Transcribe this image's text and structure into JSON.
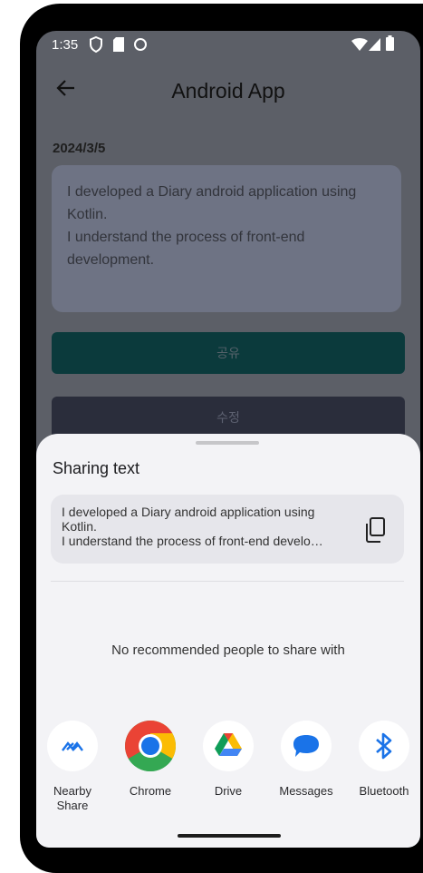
{
  "status_bar": {
    "time": "1:35"
  },
  "app_bar": {
    "title": "Android App"
  },
  "diary": {
    "date": "2024/3/5",
    "content": "I developed a Diary android application using Kotlin.\nI understand the process of front-end development."
  },
  "buttons": {
    "share_label": "공유",
    "edit_label": "수정"
  },
  "share_sheet": {
    "title": "Sharing text",
    "preview_text": "I developed a Diary android application using Kotlin.\nI understand the process of front-end develo…",
    "no_recommendations": "No recommended people to share with",
    "apps": [
      {
        "label": "Nearby Share",
        "icon": "nearby-share-icon"
      },
      {
        "label": "Chrome",
        "icon": "chrome-icon"
      },
      {
        "label": "Drive",
        "icon": "drive-icon"
      },
      {
        "label": "Messages",
        "icon": "messages-icon"
      },
      {
        "label": "Bluetooth",
        "icon": "bluetooth-icon"
      }
    ]
  },
  "colors": {
    "accent": "#1a73e8",
    "scrim": "#5c5f67",
    "sheet": "#f3f3f6"
  }
}
